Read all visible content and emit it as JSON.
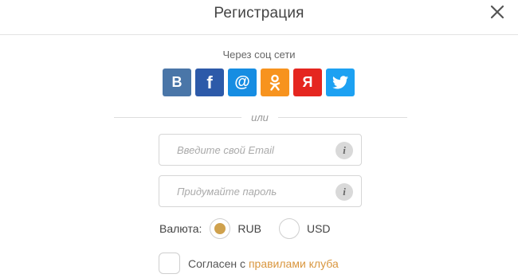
{
  "header": {
    "title": "Регистрация"
  },
  "social": {
    "label": "Через соц сети",
    "buttons": [
      {
        "id": "vk",
        "glyph": "B",
        "icon": "vk-icon",
        "color": "#4a76a8"
      },
      {
        "id": "fb",
        "glyph": "f",
        "icon": "facebook-icon",
        "color": "#2d5aa9"
      },
      {
        "id": "mail",
        "glyph": "@",
        "icon": "mailru-icon",
        "color": "#168de2"
      },
      {
        "id": "ok",
        "glyph": "ok",
        "icon": "odnoklassniki-icon",
        "color": "#f7931e"
      },
      {
        "id": "ya",
        "glyph": "Я",
        "icon": "yandex-icon",
        "color": "#e52620"
      },
      {
        "id": "tw",
        "glyph": "tw",
        "icon": "twitter-icon",
        "color": "#1da1f2"
      }
    ]
  },
  "divider": {
    "text": "или"
  },
  "form": {
    "email": {
      "placeholder": "Введите свой Email",
      "value": ""
    },
    "password": {
      "placeholder": "Придумайте пароль",
      "value": ""
    },
    "info_glyph": "i",
    "currency": {
      "label": "Валюта:",
      "options": [
        {
          "label": "RUB",
          "selected": true
        },
        {
          "label": "USD",
          "selected": false
        }
      ],
      "accent": "#cfa14d"
    },
    "agree": {
      "text": "Согласен с ",
      "link": "правилами клуба",
      "checked": false,
      "link_color": "#d9963e"
    }
  }
}
